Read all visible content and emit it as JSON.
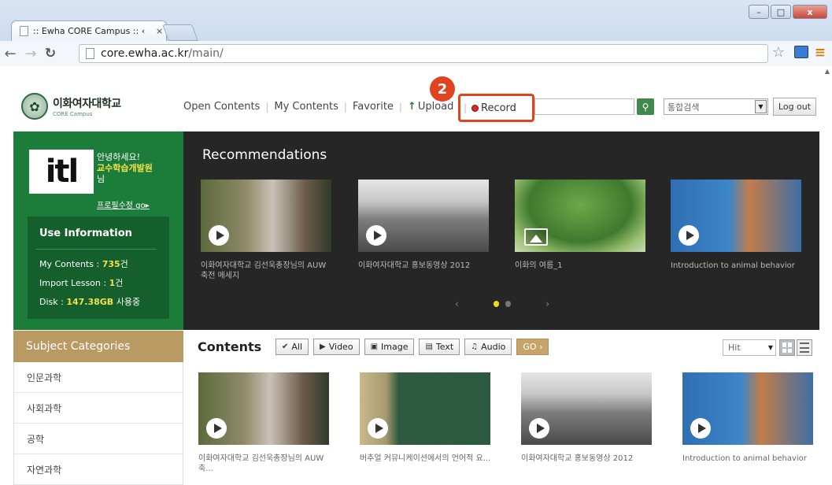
{
  "browser": {
    "tab_title": ":: Ewha CORE Campus :: ‹",
    "tab_close": "×",
    "url_host": "core.ewha.ac.kr",
    "url_path": "/main/",
    "win_min": "–",
    "win_max": "□",
    "win_close": "x"
  },
  "header": {
    "logo_kr": "이화여자대학교",
    "logo_en": "CORE Campus",
    "nav": {
      "open_contents": "Open Contents",
      "my_contents": "My Contents",
      "favorite": "Favorite",
      "upload": "Upload",
      "record": "Record"
    },
    "badge": "2",
    "search_value": "",
    "search_scope": "통합검색",
    "logout": "Log out"
  },
  "profile": {
    "logo": "itl",
    "greeting": "안녕하세요!",
    "name": "교수학습개발원",
    "suffix": "님",
    "profile_link": "프로필수정 go▸"
  },
  "use_info": {
    "title": "Use Information",
    "my_contents_label": "My Contents : ",
    "my_contents_value": "735",
    "my_contents_unit": "건",
    "import_label": "Import Lesson : ",
    "import_value": "1",
    "import_unit": "건",
    "disk_label": "Disk : ",
    "disk_value": "147.38GB",
    "disk_unit": " 사용중"
  },
  "recommendations": {
    "title": "Recommendations",
    "items": [
      {
        "caption": "이화여자대학교 김선욱총장님의 AUW 축전 메세지",
        "icon": "play-icon"
      },
      {
        "caption": "이화여자대학교 홍보동영상 2012",
        "icon": "play-icon"
      },
      {
        "caption": "이화의 여름_1",
        "icon": "image-icon"
      },
      {
        "caption": "Introduction to animal behavior",
        "icon": "play-icon"
      }
    ],
    "prev": "‹",
    "next": "›"
  },
  "subjects": {
    "title": "Subject Categories",
    "items": [
      "인문과학",
      "사회과학",
      "공학",
      "자연과학"
    ]
  },
  "contents": {
    "title": "Contents",
    "filters": {
      "all": "All",
      "video": "Video",
      "image": "Image",
      "text": "Text",
      "audio": "Audio",
      "go": "GO ›"
    },
    "sort": "Hit",
    "items": [
      {
        "caption": "이화여자대학교 김선욱총장님의 AUW 축..."
      },
      {
        "caption": "버추얼 커뮤니케이션에서의 언어적 요..."
      },
      {
        "caption": "이화여자대학교 홍보동영상 2012"
      },
      {
        "caption": "Introduction to animal behavior"
      }
    ]
  },
  "colors": {
    "brand_green": "#1c7d3a",
    "accent_gold": "#b89a62",
    "highlight_red": "#e2431e",
    "highlight_yellow": "#f4e04a"
  }
}
